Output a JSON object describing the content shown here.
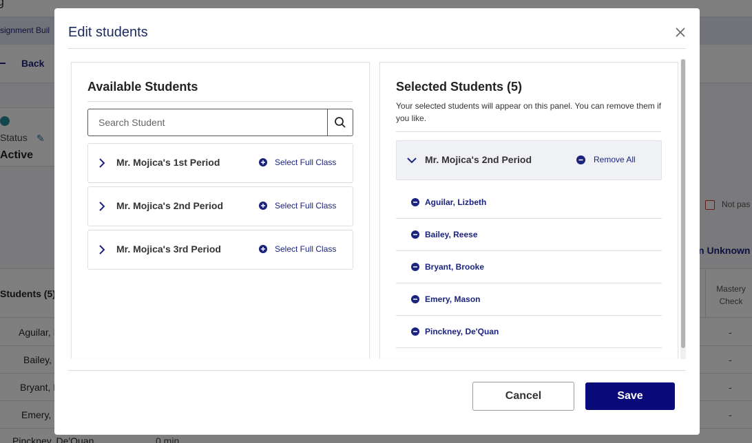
{
  "background": {
    "header_text": "g",
    "breadcrumb": "ssignment Buil",
    "back_label": "Back",
    "status_label": "Status",
    "status_value": "Active",
    "not_passed_label": "Not pas",
    "unknown_label": "n Unknown",
    "students_header": "Students (5)",
    "mastery_header": "Mastery Check",
    "rows": [
      {
        "name": "Aguilar, L",
        "value": "-"
      },
      {
        "name": "Bailey, R",
        "value": "-"
      },
      {
        "name": "Bryant, B",
        "value": "-"
      },
      {
        "name": "Emery, M",
        "value": "-"
      },
      {
        "name": "Pinckney, De'Quan",
        "extra": "0 min"
      }
    ]
  },
  "modal": {
    "title": "Edit students",
    "available": {
      "title": "Available Students",
      "search_placeholder": "Search Student",
      "classes": [
        {
          "name": "Mr. Mojica's 1st Period",
          "action": "Select Full Class"
        },
        {
          "name": "Mr. Mojica's 2nd Period",
          "action": "Select Full Class"
        },
        {
          "name": "Mr. Mojica's 3rd Period",
          "action": "Select Full Class"
        }
      ]
    },
    "selected": {
      "title": "Selected Students (5)",
      "description": "Your selected students will appear on this panel. You can remove them if you like.",
      "group": {
        "name": "Mr. Mojica's 2nd Period",
        "action": "Remove All"
      },
      "students": [
        "Aguilar, Lizbeth",
        "Bailey, Reese",
        "Bryant, Brooke",
        "Emery, Mason",
        "Pinckney, De'Quan"
      ]
    },
    "cancel_label": "Cancel",
    "save_label": "Save"
  },
  "colors": {
    "accent": "#1a237e",
    "primary_button": "#0a0a7a",
    "title": "#1b2a5c"
  }
}
